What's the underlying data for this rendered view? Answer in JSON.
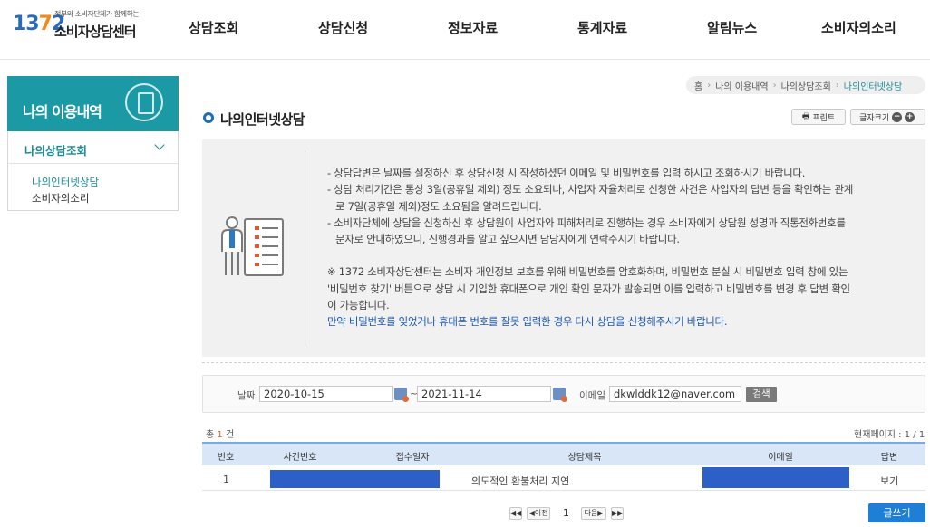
{
  "header": {
    "logo_number": "1372",
    "logo_tagline": "정부와 소비자단체가 함께하는",
    "logo_name": "소비자상담센터",
    "nav": [
      "상담조회",
      "상담신청",
      "정보자료",
      "통계자료",
      "알림뉴스",
      "소비자의소리"
    ]
  },
  "sidebar": {
    "title": "나의 이용내역",
    "menu_label": "나의상담조회",
    "sub_items": [
      "나의인터넷상담",
      "소비자의소리"
    ]
  },
  "breadcrumb": [
    "홈",
    "나의 이용내역",
    "나의상담조회",
    "나의인터넷상담"
  ],
  "page": {
    "title": "나의인터넷상담",
    "print_label": "프린트",
    "font_label": "글자크기"
  },
  "notice": {
    "lines": [
      "- 상담답변은 날짜를 설정하신 후 상담신청 시 작성하셨던 이메일 및 비밀번호를 입력 하시고 조회하시기 바랍니다.",
      "- 상담 처리기간은 통상 3일(공휴일 제외) 정도 소요되나, 사업자 자율처리로 신청한 사건은 사업자의 답변 등을 확인하는 관계",
      "로 7일(공휴일 제외)정도 소요됨을 알려드립니다.",
      "- 소비자단체에 상담을 신청하신 후 상담원이 사업자와 피해처리로 진행하는 경우 소비자에게 상담원 성명과 직통전화번호를",
      "문자로 안내하였으니, 진행경과를 알고 싶으시면 담당자에게 연락주시기 바랍니다.",
      "※ 1372 소비자상담센터는 소비자 개인정보 보호를 위해 비밀번호를 암호화하며, 비밀번호 분실 시 비밀번호 입력 창에 있는",
      "'비밀번호 찾기' 버튼으로 상담 시 기입한 휴대폰으로 개인 확인 문자가 발송되면 이를 입력하고 비밀번호를 변경 후 답변 확인",
      "이 가능합니다.",
      "만약 비밀번호를 잊었거나 휴대폰 번호를 잘못 입력한 경우 다시 상담을 신청해주시기 바랍니다."
    ]
  },
  "search": {
    "date_label": "날짜",
    "date_from": "2020-10-15",
    "tilde": "~",
    "date_to": "2021-11-14",
    "email_label": "이메일",
    "email_value": "dkwlddk12@naver.com",
    "button": "검색"
  },
  "list": {
    "total_prefix": "총",
    "total_count": "1",
    "total_suffix": "건",
    "page_info": "현재페이지 : 1 / 1",
    "columns": [
      "번호",
      "사건번호",
      "접수일자",
      "상담제목",
      "이메일",
      "답변"
    ],
    "rows": [
      {
        "no": "1",
        "subject": "의도적인 환불처리 지연",
        "answer": "보기"
      }
    ]
  },
  "pagination": {
    "first": "◀◀",
    "prev": "◀이전",
    "current": "1",
    "next": "다음▶",
    "last": "▶▶"
  },
  "write_button": "글쓰기",
  "colors": {
    "brand_teal": "#1b9aa6",
    "accent_blue": "#1c6fb5",
    "redaction": "#2d5fc9"
  }
}
